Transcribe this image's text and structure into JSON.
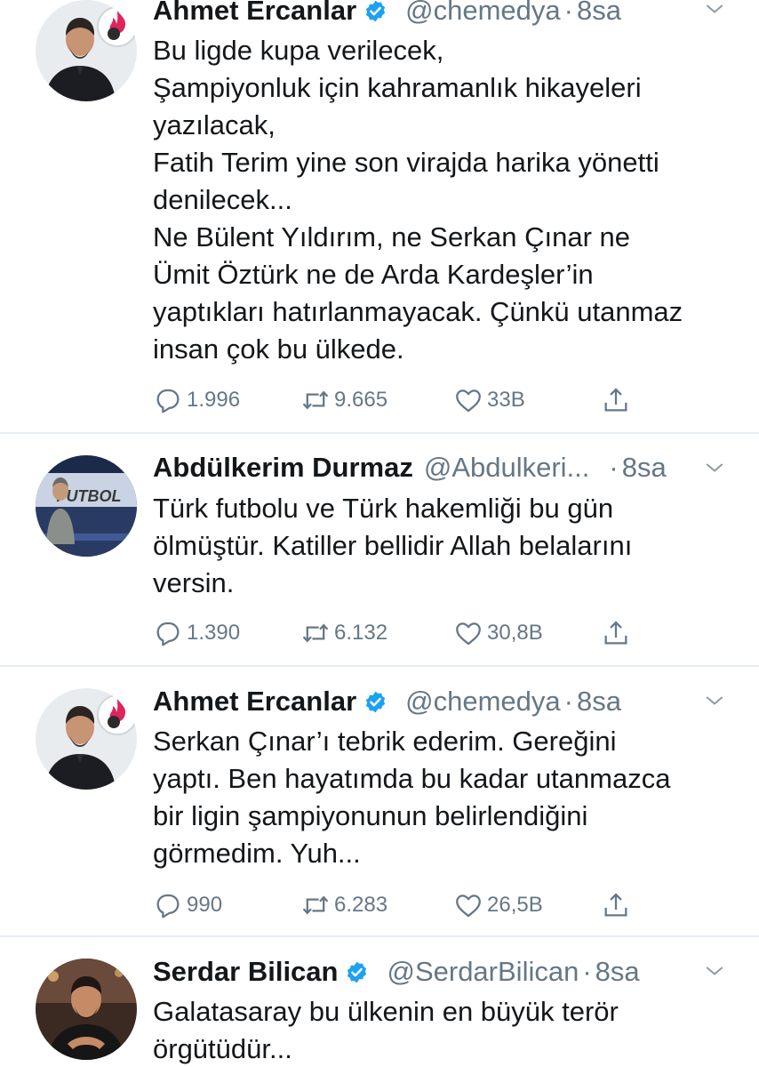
{
  "tweets": [
    {
      "author": "Ahmet Ercanlar",
      "verified": true,
      "handle": "@chemedya",
      "separator": "·",
      "time": "8sa",
      "lines": [
        "Bu ligde kupa verilecek,",
        "Şampiyonluk için kahramanlık hikayeleri",
        "yazılacak,",
        "Fatih Terim yine son virajda harika yönetti",
        "denilecek...",
        "Ne Bülent Yıldırım, ne Serkan Çınar ne",
        "Ümit Öztürk ne de Arda Kardeşler’in",
        "yaptıkları hatırlanmayacak. Çünkü utanmaz",
        "insan çok bu ülkede."
      ],
      "replies": "1.996",
      "retweets": "9.665",
      "likes": "33B"
    },
    {
      "author": "Abdülkerim Durmaz",
      "verified": false,
      "handle": "@Abdulkeri...",
      "separator": "·",
      "time": "8sa",
      "lines": [
        "Türk futbolu ve Türk hakemliği bu gün",
        "ölmüştür. Katiller bellidir Allah belalarını",
        "versin."
      ],
      "replies": "1.390",
      "retweets": "6.132",
      "likes": "30,8B"
    },
    {
      "author": "Ahmet Ercanlar",
      "verified": true,
      "handle": "@chemedya",
      "separator": "·",
      "time": "8sa",
      "lines": [
        "Serkan Çınar’ı tebrik ederim. Gereğini",
        "yaptı.  Ben hayatımda bu kadar utanmazca",
        "bir ligin şampiyonunun belirlendiğini",
        "görmedim. Yuh..."
      ],
      "replies": "990",
      "retweets": "6.283",
      "likes": "26,5B"
    },
    {
      "author": "Serdar Bilican",
      "verified": true,
      "handle": "@SerdarBilican",
      "separator": "·",
      "time": "8sa",
      "lines": [
        "Galatasaray bu ülkenin en büyük terör",
        "örgütüdür..."
      ]
    }
  ],
  "colors": {
    "text": "#14171a",
    "muted": "#657786",
    "verified": "#1da1f2",
    "divider": "#e6ecf0"
  },
  "icons": [
    "reply-icon",
    "retweet-icon",
    "like-icon",
    "share-icon",
    "verified-badge-icon",
    "chevron-down-icon"
  ],
  "avatar_text": {
    "futbol_backdrop": "FUTBOL"
  }
}
